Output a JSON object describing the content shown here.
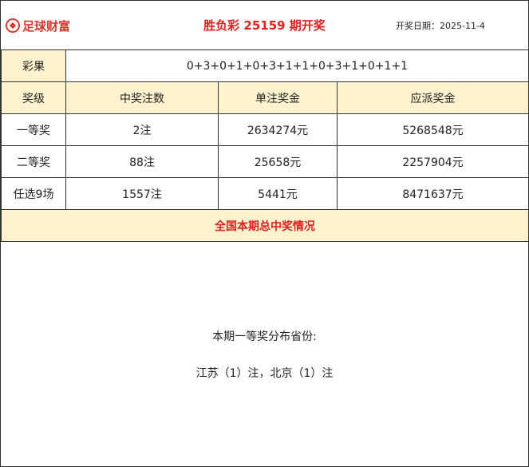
{
  "header": {
    "logo_text": "足球财富",
    "title": "胜负彩 25159 期开奖",
    "date_label": "开奖日期：",
    "date_value": "2025-11-4"
  },
  "result": {
    "label": "彩果",
    "value": "0+3+0+1+0+3+1+1+0+3+1+0+1+1"
  },
  "prize_table": {
    "headers": [
      "奖级",
      "中奖注数",
      "单注奖金",
      "应派奖金"
    ],
    "rows": [
      [
        "一等奖",
        "2注",
        "2634274元",
        "5268548元"
      ],
      [
        "二等奖",
        "88注",
        "25658元",
        "2257904元"
      ],
      [
        "任选9场",
        "1557注",
        "5441元",
        "8471637元"
      ]
    ]
  },
  "summary": {
    "title": "全国本期总中奖情况",
    "distribution_title": "本期一等奖分布省份:",
    "distribution_list": "江苏（1）注，北京（1）注"
  },
  "colors": {
    "accent_red": "#e0201f",
    "header_bg": "#fff2cf"
  }
}
